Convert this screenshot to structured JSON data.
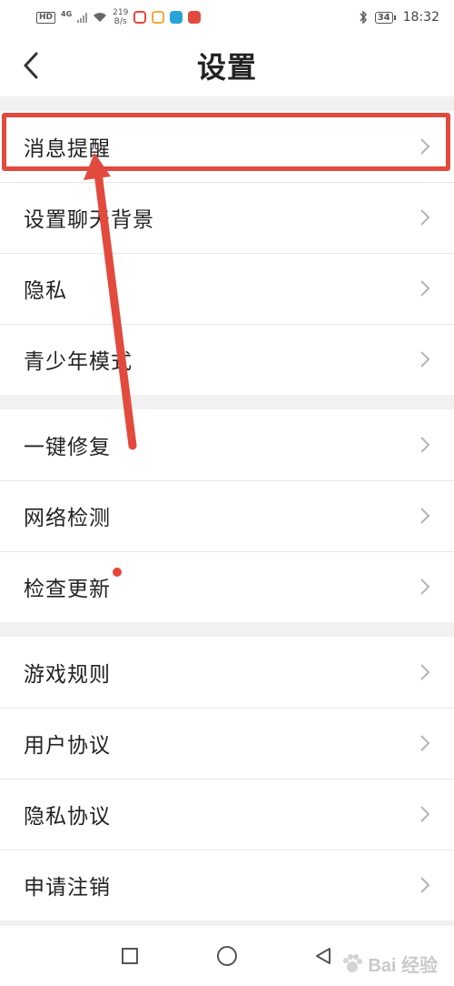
{
  "status_bar": {
    "hd": "HD",
    "network": "4G",
    "speed_value": "219",
    "speed_unit": "B/s",
    "battery": "34",
    "time": "18:32",
    "app_colors": [
      "#e8463d",
      "#f2a93b",
      "#27a3d8",
      "#e24a3e"
    ]
  },
  "header": {
    "title": "设置",
    "back_icon": "chevron-left-icon"
  },
  "groups": [
    {
      "items": [
        {
          "label": "消息提醒"
        },
        {
          "label": "设置聊天背景"
        },
        {
          "label": "隐私"
        },
        {
          "label": "青少年模式"
        }
      ]
    },
    {
      "items": [
        {
          "label": "一键修复"
        },
        {
          "label": "网络检测"
        },
        {
          "label": "检查更新",
          "badge": "red-dot"
        }
      ]
    },
    {
      "items": [
        {
          "label": "游戏规则"
        },
        {
          "label": "用户协议"
        },
        {
          "label": "隐私协议"
        },
        {
          "label": "申请注销"
        }
      ]
    }
  ],
  "nav": {
    "recent_icon": "square-icon",
    "home_icon": "circle-icon",
    "back_icon": "triangle-back-icon"
  },
  "watermark": {
    "text": "Bai 经验"
  },
  "colors": {
    "annotation": "#e24a3e",
    "badge": "#e8463d",
    "divider": "#e6e6e6",
    "group_gap": "#f1f1f1"
  }
}
